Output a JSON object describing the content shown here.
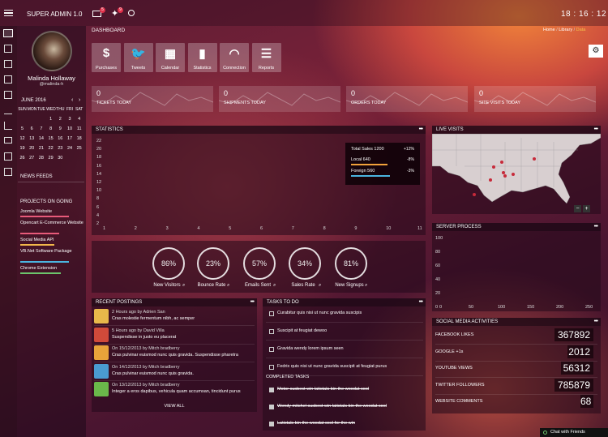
{
  "header": {
    "brand": "SUPER ADMIN 1.0",
    "mail_badge": "5",
    "notif_badge": "9",
    "clock": "18 : 16 : 12"
  },
  "profile": {
    "name": "Malinda Hollaway",
    "handle": "@malinda-h"
  },
  "calendar": {
    "month": "JUNE 2016",
    "days": [
      "SUN",
      "MON",
      "TUE",
      "WED",
      "THU",
      "FRI",
      "SAT"
    ],
    "rows": [
      [
        "",
        "",
        "",
        "1",
        "2",
        "3",
        "4"
      ],
      [
        "5",
        "6",
        "7",
        "8",
        "9",
        "10",
        "11"
      ],
      [
        "12",
        "13",
        "14",
        "15",
        "16",
        "17",
        "18"
      ],
      [
        "19",
        "20",
        "21",
        "22",
        "23",
        "24",
        "25"
      ],
      [
        "26",
        "27",
        "28",
        "29",
        "30",
        "",
        ""
      ]
    ]
  },
  "sidebar": {
    "news_feeds": "NEWS FEEDS",
    "projects_title": "PROJECTS ON GOING",
    "projects": [
      {
        "name": "Joomla Website",
        "color": "#e85a7a"
      },
      {
        "name": "Opencart E-Commerce Website",
        "color": "#e85a7a"
      },
      {
        "name": "Social Media API",
        "color": "#f2b84b"
      },
      {
        "name": "VB.Net Software Package",
        "color": "#4bb5e0"
      },
      {
        "name": "Chrome Extension",
        "color": "#6cc46c"
      }
    ]
  },
  "breadcrumb": {
    "title": "DASHBOARD",
    "home": "Home",
    "sep1": "/",
    "library": "Library",
    "sep2": "/",
    "current": "Data"
  },
  "shortcuts": [
    {
      "label": "Purchases",
      "icon": "dollar-icon"
    },
    {
      "label": "Tweets",
      "icon": "twitter-icon"
    },
    {
      "label": "Calendar",
      "icon": "calendar-icon"
    },
    {
      "label": "Statistics",
      "icon": "bar-chart-icon"
    },
    {
      "label": "Connection",
      "icon": "wifi-icon"
    },
    {
      "label": "Reports",
      "icon": "list-icon"
    }
  ],
  "stats": [
    {
      "value": "0",
      "label": "TICKETS TODAY"
    },
    {
      "value": "0",
      "label": "SHIPMENTS TODAY"
    },
    {
      "value": "0",
      "label": "ORDERS TODAY"
    },
    {
      "value": "0",
      "label": "SITE VISITS TODAY"
    }
  ],
  "statistics_panel": {
    "title": "STATISTICS",
    "yticks": [
      "22",
      "20",
      "18",
      "16",
      "14",
      "12",
      "10",
      "8",
      "6",
      "4",
      "2"
    ],
    "xticks": [
      "1",
      "2",
      "3",
      "4",
      "5",
      "6",
      "7",
      "8",
      "9",
      "10",
      "11"
    ],
    "sales": {
      "total_label": "Total Sales 1200",
      "total_change": "+12%",
      "local_label": "Local 640",
      "local_change": "-8%",
      "foreign_label": "Foreign 560",
      "foreign_change": "-3%"
    }
  },
  "live_visits": {
    "title": "LIVE VISITS",
    "zoom_out": "−",
    "zoom_in": "+"
  },
  "server_process": {
    "title": "SERVER PROCESS",
    "yticks": [
      "100",
      "80",
      "60",
      "40",
      "20",
      "0"
    ],
    "xticks": [
      "0",
      "50",
      "100",
      "150",
      "200",
      "250"
    ]
  },
  "gauges": [
    {
      "value": "86%",
      "label": "New Visitors",
      "pct": 0.86
    },
    {
      "value": "23%",
      "label": "Bounce Rate",
      "pct": 0.23
    },
    {
      "value": "57%",
      "label": "Emails Sent",
      "pct": 0.57
    },
    {
      "value": "34%",
      "label": "Sales Rate",
      "pct": 0.34
    },
    {
      "value": "81%",
      "label": "New Signups",
      "pct": 0.81
    }
  ],
  "recent_postings": {
    "title": "RECENT POSTINGS",
    "view_all": "VIEW ALL",
    "posts": [
      {
        "meta": "2 Hours ago by Adrien San",
        "text": "Cras molestie fermentum nibh, ac semper"
      },
      {
        "meta": "5 Hours ago by David Villa",
        "text": "Suspendisse in justo eu placerat"
      },
      {
        "meta": "On 15/12/2013 by Mitch bradberry",
        "text": "Cras pulvinar euismod nunc quis gravida. Suspendisse pharetra"
      },
      {
        "meta": "On 14/12/2013 by Mitch bradberry",
        "text": "Cras pulvinar euismod nunc quis gravida."
      },
      {
        "meta": "On 13/12/2013 by Mitch bradberry",
        "text": "Integer a eros dapibus, vehicula quam accumsan, tincidunt purus"
      }
    ]
  },
  "tasks": {
    "title": "TASKS TO DO",
    "items": [
      "Curabitur quis nisi ut nunc gravida suscipis",
      "Suscipit at feugiat dewoo",
      "Gravida wendy lorem ipsum seen",
      "Fedrix quis nisi ut nunc gravida suscipit at feugiat purus"
    ],
    "completed_title": "COMPLETED TASKS",
    "completed": [
      "Motor susbect win latictals bin the woodat cool",
      "Wendy mitchel susbect win latictals bin the woodat cool",
      "Latictals bin the woodat cool for the win"
    ]
  },
  "social": {
    "title": "SOCIAL MEDIA ACTIVITIES",
    "rows": [
      {
        "label": "FACEBOOK LIKES",
        "value": "367892"
      },
      {
        "label": "GOOGLE +1s",
        "value": "2012"
      },
      {
        "label": "YOUTUBE VIEWS",
        "value": "56312"
      },
      {
        "label": "TWITTER FOLLOWERS",
        "value": "785879"
      },
      {
        "label": "WEBSITE COMMENTS",
        "value": "68"
      }
    ]
  },
  "chat": {
    "label": "Chat with Friends"
  }
}
